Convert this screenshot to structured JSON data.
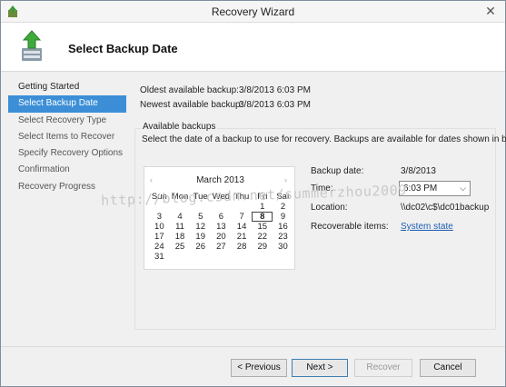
{
  "window": {
    "title": "Recovery Wizard",
    "close_glyph": "✕"
  },
  "header": {
    "title": "Select Backup Date",
    "icon": "backup-restore-icon"
  },
  "nav": {
    "items": [
      {
        "label": "Getting Started",
        "state": "done"
      },
      {
        "label": "Select Backup Date",
        "state": "active"
      },
      {
        "label": "Select Recovery Type",
        "state": "pending"
      },
      {
        "label": "Select Items to Recover",
        "state": "pending"
      },
      {
        "label": "Specify Recovery Options",
        "state": "pending"
      },
      {
        "label": "Confirmation",
        "state": "pending"
      },
      {
        "label": "Recovery Progress",
        "state": "pending"
      }
    ]
  },
  "summary": {
    "oldest_label": "Oldest available backup:",
    "oldest_value": "3/8/2013 6:03 PM",
    "newest_label": "Newest available backup:",
    "newest_value": "3/8/2013 6:03 PM"
  },
  "available": {
    "group_label": "Available backups",
    "description": "Select the date of a backup to use for recovery. Backups are available for dates shown in bold."
  },
  "calendar": {
    "month": "March 2013",
    "prev": "‹",
    "next": "›",
    "weekdays": [
      "Sun",
      "Mon",
      "Tue",
      "Wed",
      "Thu",
      "Fri",
      "Sat"
    ],
    "weeks": [
      [
        "",
        "",
        "",
        "",
        "",
        "1",
        "2"
      ],
      [
        "3",
        "4",
        "5",
        "6",
        "7",
        "8",
        "9"
      ],
      [
        "10",
        "11",
        "12",
        "13",
        "14",
        "15",
        "16"
      ],
      [
        "17",
        "18",
        "19",
        "20",
        "21",
        "22",
        "23"
      ],
      [
        "24",
        "25",
        "26",
        "27",
        "28",
        "29",
        "30"
      ],
      [
        "31",
        "",
        "",
        "",
        "",
        "",
        ""
      ]
    ],
    "selected_day": "8"
  },
  "details": {
    "backup_date_label": "Backup date:",
    "backup_date_value": "3/8/2013",
    "time_label": "Time:",
    "time_value": "6:03 PM",
    "location_label": "Location:",
    "location_value": "\\\\dc02\\c$\\dc01backup",
    "items_label": "Recoverable items:",
    "items_link": "System state"
  },
  "watermark": "http://blog.csdn.net/summerzhou2009",
  "buttons": {
    "previous": "< Previous",
    "next": "Next >",
    "recover": "Recover",
    "cancel": "Cancel"
  },
  "colors": {
    "nav_active": "#3c8fd6",
    "link": "#1c5eb4"
  }
}
